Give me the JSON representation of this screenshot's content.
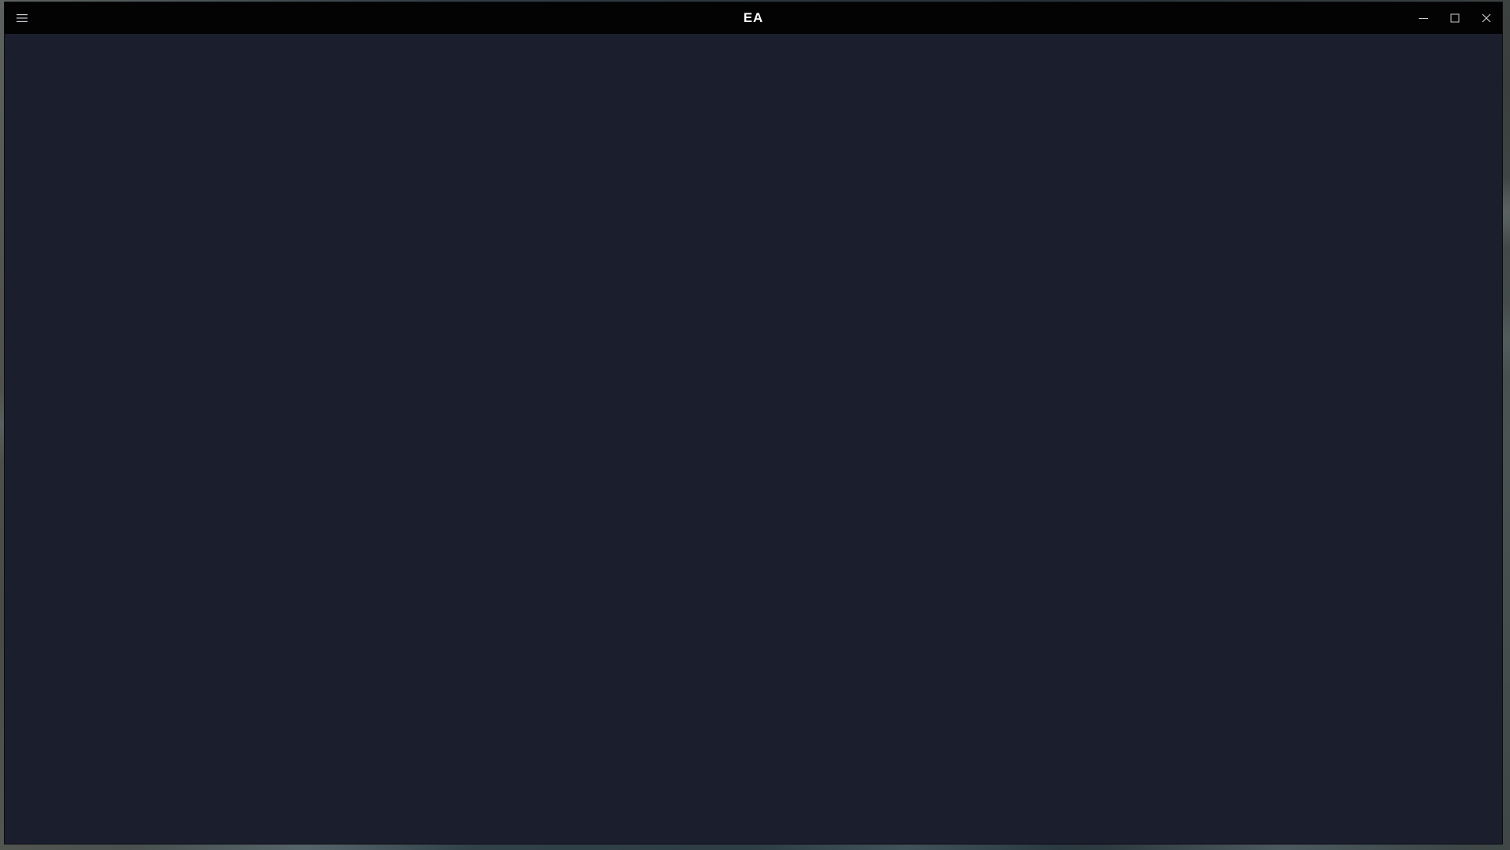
{
  "window": {
    "title_logo": "EA",
    "controls": {
      "minimize_icon": "minimize-icon",
      "maximize_icon": "maximize-icon",
      "close_icon": "close-icon"
    },
    "menu_icon": "hamburger-menu-icon"
  },
  "colors": {
    "title_bar": "#030304",
    "content_background": "#1b1e2c",
    "icon": "#c8cad0",
    "logo": "#ffffff"
  }
}
